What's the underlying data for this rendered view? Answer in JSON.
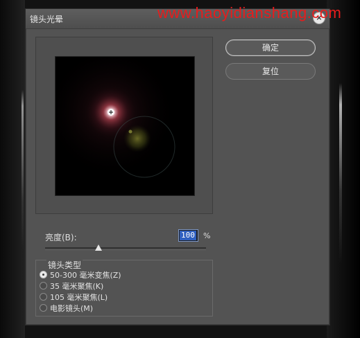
{
  "window": {
    "title": "镜头光晕",
    "watermark": "www.haoyidianshang.com",
    "close_glyph": "×"
  },
  "buttons": {
    "ok_label": "确定",
    "reset_label": "复位"
  },
  "brightness": {
    "label": "亮度(B):",
    "value": "100",
    "unit": "%",
    "slider_fraction": 0.33
  },
  "lens_type": {
    "legend": "镜头类型",
    "options": [
      {
        "label": "50-300 毫米变焦(Z)",
        "selected": true
      },
      {
        "label": "35 毫米聚焦(K)",
        "selected": false
      },
      {
        "label": "105 毫米聚焦(L)",
        "selected": false
      },
      {
        "label": "电影镜头(M)",
        "selected": false
      }
    ]
  },
  "icons": {
    "close": "close-icon",
    "flare_center": "crosshair-icon"
  },
  "colors": {
    "dialog_bg": "#535353",
    "watermark": "#e81c1c",
    "input_highlight": "#2f5fbf",
    "flare_core": "#ffffff",
    "flare_halo": "#c84b5a",
    "flare_secondary": "#9fa23a"
  }
}
